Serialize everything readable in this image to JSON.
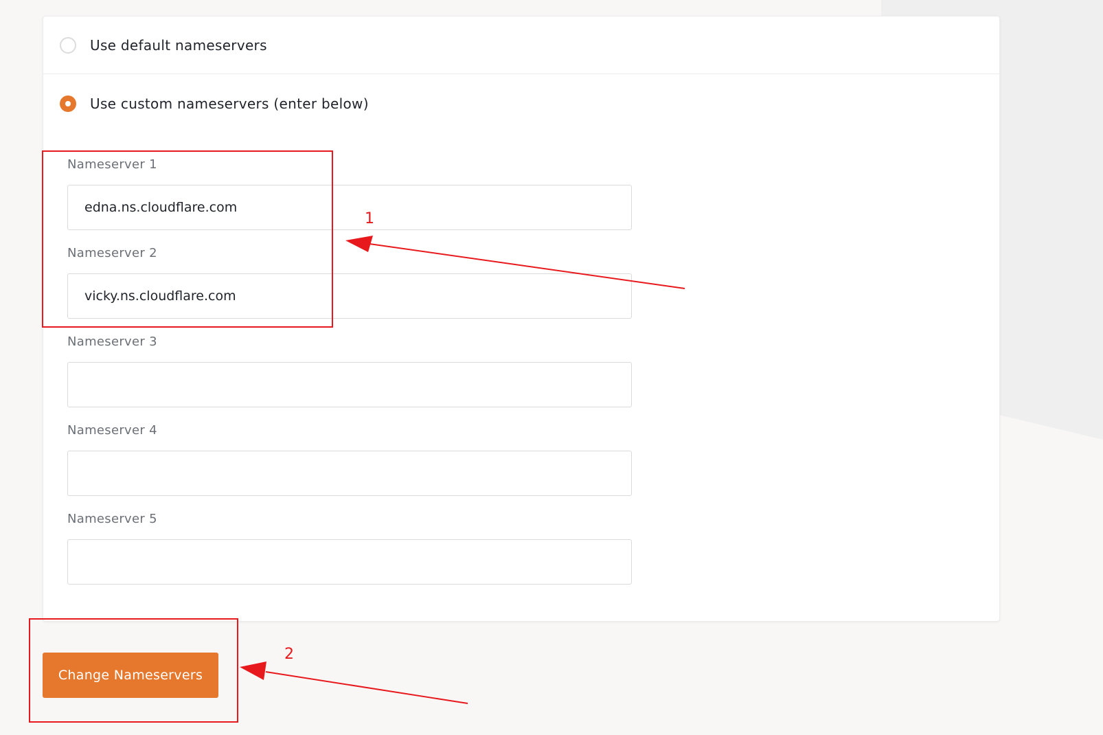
{
  "form": {
    "options": [
      {
        "label": "Use default nameservers",
        "selected": false
      },
      {
        "label": "Use custom nameservers (enter below)",
        "selected": true
      }
    ],
    "nameservers": [
      {
        "label": "Nameserver 1",
        "value": "edna.ns.cloudflare.com"
      },
      {
        "label": "Nameserver 2",
        "value": "vicky.ns.cloudflare.com"
      },
      {
        "label": "Nameserver 3",
        "value": ""
      },
      {
        "label": "Nameserver 4",
        "value": ""
      },
      {
        "label": "Nameserver 5",
        "value": ""
      }
    ],
    "submit_label": "Change Nameservers"
  },
  "annotations": {
    "step1_number": "1",
    "step2_number": "2",
    "color": "#e8191c"
  },
  "colors": {
    "accent": "#e6782e",
    "page_background": "#f8f7f6"
  }
}
